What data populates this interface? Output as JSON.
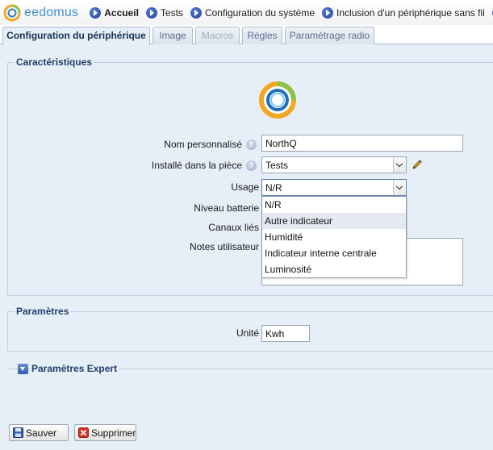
{
  "app": {
    "logo_text": "eedomus"
  },
  "nav": {
    "items": [
      {
        "label": "Accueil"
      },
      {
        "label": "Tests"
      },
      {
        "label": "Configuration du système"
      },
      {
        "label": "Inclusion d'un périphérique sans fil"
      },
      {
        "label": "En"
      }
    ]
  },
  "tabs": [
    {
      "label": "Configuration du périphérique",
      "state": "active"
    },
    {
      "label": "Image",
      "state": "normal"
    },
    {
      "label": "Macros",
      "state": "disabled"
    },
    {
      "label": "Règles",
      "state": "normal"
    },
    {
      "label": "Paramétrage radio",
      "state": "normal"
    }
  ],
  "characteristics": {
    "legend": "Caractéristiques",
    "name_label": "Nom personnalisé",
    "name_value": "NorthQ",
    "room_label": "Installé dans la pièce",
    "room_value": "Tests",
    "usage_label": "Usage",
    "usage_value": "N/R",
    "usage_options": [
      "N/R",
      "Autre indicateur",
      "Humidité",
      "Indicateur interne centrale",
      "Luminosité"
    ],
    "usage_hovered": "Autre indicateur",
    "battery_label": "Niveau batterie",
    "channels_label": "Canaux liés",
    "notes_label": "Notes utilisateur",
    "notes_value": ""
  },
  "parameters": {
    "legend": "Paramètres",
    "unit_label": "Unité",
    "unit_value": "Kwh"
  },
  "expert": {
    "legend": "Paramètres Expert"
  },
  "actions": {
    "save_label": "Sauver",
    "delete_label": "Supprimer"
  },
  "colors": {
    "accent": "#3f8fd2",
    "legend": "#1f3f6a",
    "background": "#e6eef8"
  }
}
